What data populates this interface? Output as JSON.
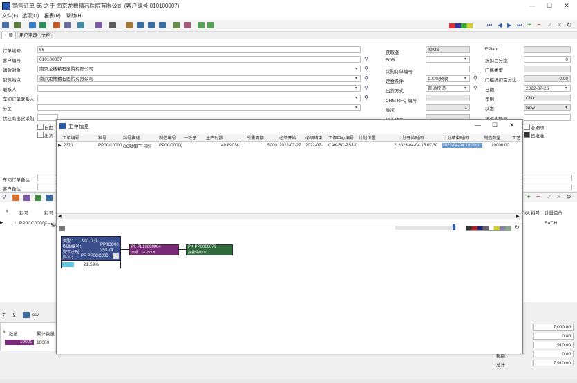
{
  "window": {
    "title": "销售订单 66 之于 南京龙穗精石医院有限公司 (客户编号 010100007)",
    "min": "—",
    "max": "☐",
    "close": "✕"
  },
  "menu": [
    "文件(F)",
    "选项(O)",
    "报表(R)",
    "帮助(H)"
  ],
  "tabs": [
    "一般",
    "用户字段",
    "文档"
  ],
  "form": {
    "order_no_label": "订单编号",
    "order_no": "66",
    "cust_no_label": "客户编号",
    "cust_no": "010100007",
    "bill_to_label": "请款对象",
    "bill_to": "南京龙穗精石医院有限公司",
    "ship_to_label": "到货地点",
    "ship_to": "南京龙穗精石医院有限公司",
    "contact_label": "联系人",
    "workshop_contact_label": "车间订单联系人",
    "branch_label": "分区",
    "supplier_label": "供应商出货采购",
    "cb1": "自由",
    "cb2": "出货",
    "receiver_label": "获取者",
    "receiver": "IQMS",
    "fob_label": "FOB",
    "po_label": "采购订单编号",
    "cond_label": "定金条件",
    "cond": "100%预收",
    "ship_method_label": "出货方式",
    "ship_method": "普通快递",
    "crm_label": "CRM RFQ 编号",
    "version_label": "版次",
    "version": "1",
    "opportunity_label": "机会编号",
    "eplant_label": "EPlant",
    "discount_label": "折扣百分比",
    "discount": "0",
    "gate_type_label": "门槛类型",
    "gate_pct_label": "门槛折扣百分比",
    "gate_pct": "0.00",
    "date_label": "日期",
    "date": "2022-07-26",
    "currency_label": "币别",
    "currency": "CNY",
    "status_label": "状态",
    "status": "New",
    "accountant_label": "承运人帐号",
    "right_cb1": "必确项",
    "right_cb2": "已批准",
    "workshop_note_label": "车间订单备注",
    "cust_note_label": "客户备注"
  },
  "lower_grid": {
    "col_no": "#",
    "col_item": "料号",
    "col_item2": "料号",
    "row_no": "1",
    "row_item": "PP0CC0000C",
    "row_item2": "CC轴帽",
    "col_tka": "TKA 料号",
    "col_unit": "计量单位",
    "unit": "EACH"
  },
  "dialog": {
    "title": "工单信息",
    "headers": [
      "工单编号",
      "料号",
      "料号描述",
      "制造编号",
      "一致子",
      "生产时数",
      "所需周期",
      "必须开始",
      "必须结束",
      "工作中心编号",
      "计划位置",
      "",
      "计划开始时间",
      "计划结束时间",
      "制造数量",
      "工艺"
    ],
    "row": [
      "2371",
      "PP0CC0000",
      "CC轴帽下卡圈",
      "PP0CC000(",
      "",
      "49.890341",
      "5000",
      "2022-07-27",
      "2022-07-",
      "CAK-SC-ZSJ-0",
      "",
      "2",
      "2023-04-04 15:07:30",
      "2023-04-04 19:30:1",
      "10000.00",
      ""
    ],
    "node1": {
      "l1": "类型：",
      "v1": "90T立式",
      "l2": "制品编号：",
      "v2": "PP0CC00",
      "l3": "完工小时：",
      "v3": "253.74",
      "l4": "料号：",
      "v4": "PP PP0CC000",
      "pct": "21.59%"
    },
    "node2": {
      "l1": "PL PL10000004",
      "l2": "日期工 2022.08"
    },
    "node3": {
      "l1": "PK PP0000079",
      "l2": "数量件数 0.0"
    }
  },
  "bottom": {
    "col_qty": "数量",
    "col_cum": "累计数量",
    "qty": "10000",
    "cum": "10000",
    "totals": [
      "7,000.00",
      "0.00",
      "910.00",
      "0.00",
      "7,910.00"
    ],
    "tax_label": "税额",
    "total_label": "总计"
  },
  "colors": {
    "accent": "#2a5aa8",
    "node1": "#3a4e8c",
    "node2": "#7a2a7a",
    "node3": "#2e6a3a",
    "progress": "#5ec6e0"
  }
}
